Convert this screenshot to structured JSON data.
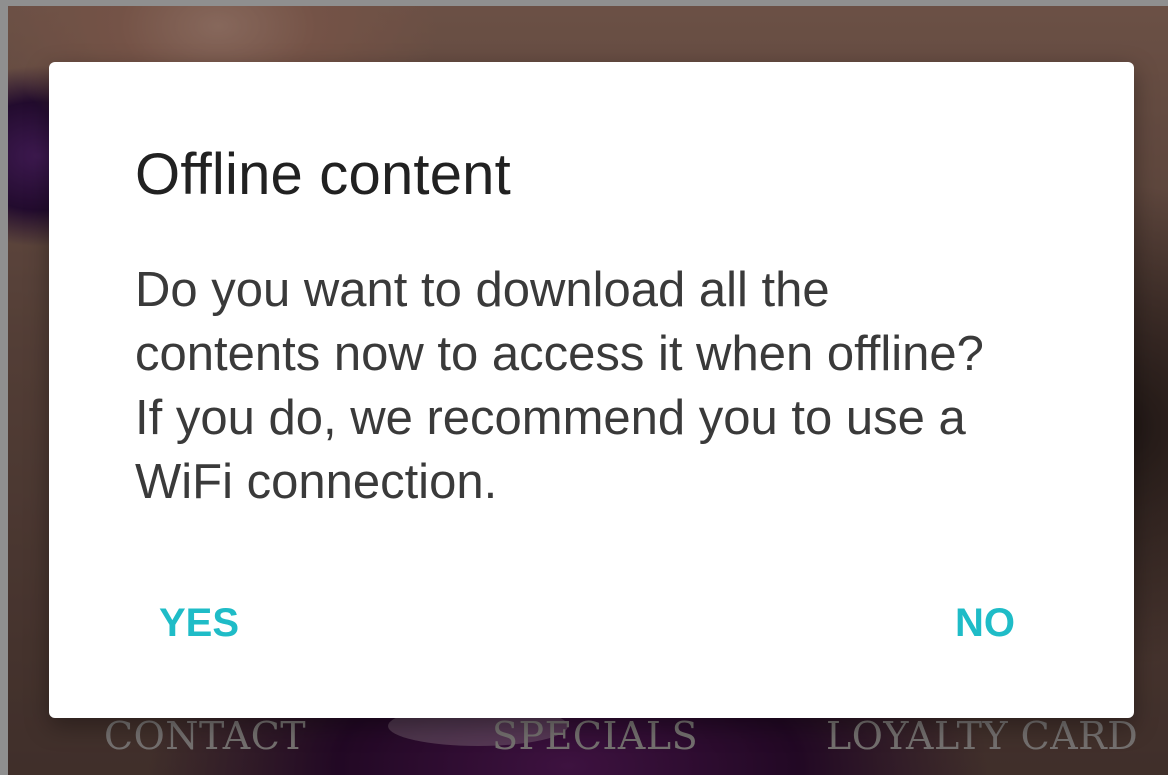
{
  "background": {
    "nav_items": [
      "CONTACT",
      "SPECIALS",
      "LOYALTY CARD"
    ]
  },
  "dialog": {
    "title": "Offline content",
    "message": "Do you want to download all the contents now to access it when offline? If you do, we recommend you to use a WiFi connection.",
    "positive_label": "YES",
    "negative_label": "NO"
  },
  "colors": {
    "accent": "#1fbcc7",
    "title_text": "#212121",
    "body_text": "#3a3a3a",
    "dialog_bg": "#ffffff"
  }
}
